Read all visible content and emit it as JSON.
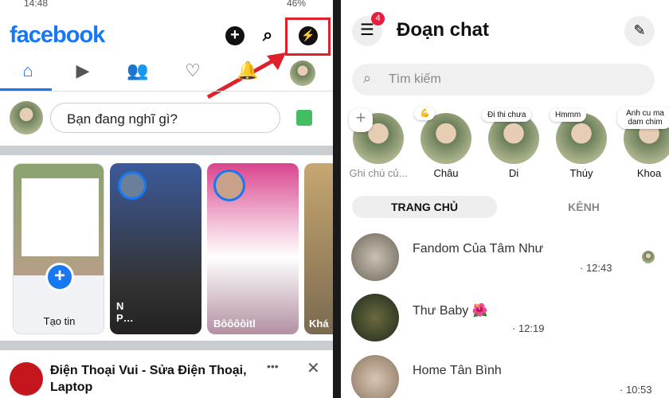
{
  "left": {
    "status": {
      "time": "14:48",
      "battery": "46%"
    },
    "logo": "facebook",
    "header_icons": [
      "plus-icon",
      "search-icon",
      "messenger-icon"
    ],
    "tabs": [
      "home-icon",
      "video-icon",
      "friends-icon",
      "dating-heart-icon",
      "bell-icon",
      "profile-menu-icon"
    ],
    "composer_placeholder": "Bạn đang nghĩ gì?",
    "stories": {
      "create_label": "Tạo tin",
      "items": [
        "N P…",
        "Bôôôôitl",
        "Khá"
      ]
    },
    "post": {
      "author": "Điện Thoại Vui - Sửa Điện Thoại, Laptop",
      "more": "•••",
      "close": "✕"
    },
    "highlight_color": "#e0202a"
  },
  "right": {
    "menu_badge": "4",
    "title": "Đoạn chat",
    "search_placeholder": "Tìm kiếm",
    "notes": [
      {
        "name": "Ghi chú củ...",
        "note": "+"
      },
      {
        "name": "Châu",
        "note": "💪"
      },
      {
        "name": "Di",
        "note": "Đi thi chưa"
      },
      {
        "name": "Thúy",
        "note": "Hmmm"
      },
      {
        "name": "Khoa",
        "note": "Anh cu ma dam chim"
      }
    ],
    "tabs": {
      "active": "TRANG CHỦ",
      "other": "KÊNH"
    },
    "chats": [
      {
        "name": "Fandom Của Tâm Như",
        "time": "· 12:43"
      },
      {
        "name": "Thư Baby 🌺",
        "time": "· 12:19"
      },
      {
        "name": "Home Tân Bình",
        "time": "· 10:53"
      }
    ]
  }
}
